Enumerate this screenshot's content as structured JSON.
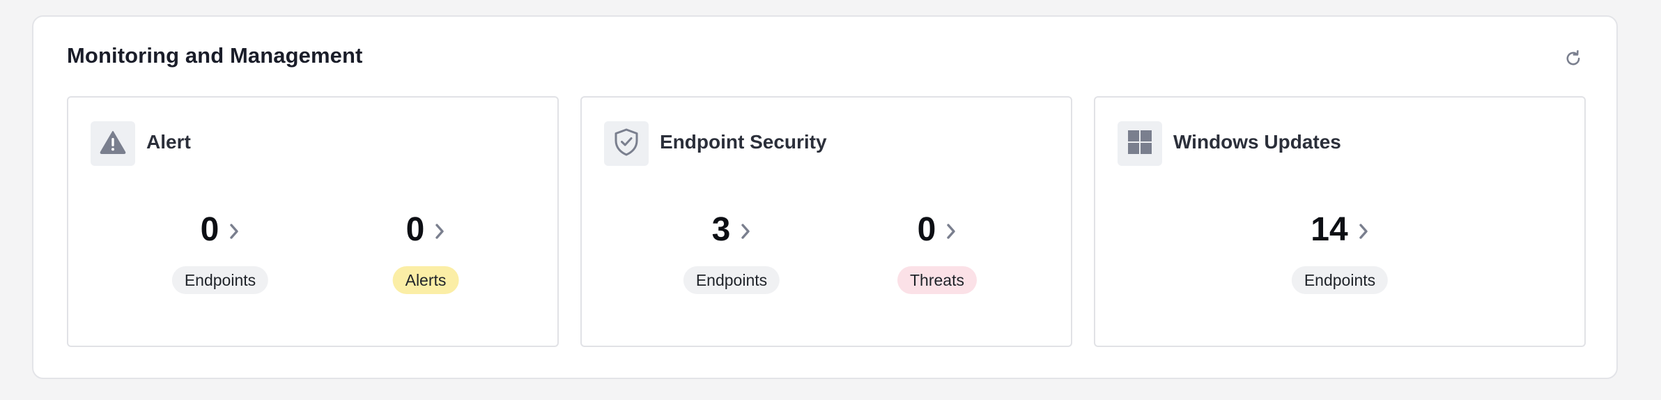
{
  "panel": {
    "title": "Monitoring and Management",
    "refresh_icon": "refresh-icon"
  },
  "cards": [
    {
      "title": "Alert",
      "icon": "warning-triangle-icon",
      "metrics": [
        {
          "value": "0",
          "label": "Endpoints",
          "tone": "neutral"
        },
        {
          "value": "0",
          "label": "Alerts",
          "tone": "yellow"
        }
      ]
    },
    {
      "title": "Endpoint Security",
      "icon": "shield-check-icon",
      "metrics": [
        {
          "value": "3",
          "label": "Endpoints",
          "tone": "neutral"
        },
        {
          "value": "0",
          "label": "Threats",
          "tone": "pink"
        }
      ]
    },
    {
      "title": "Windows Updates",
      "icon": "windows-logo-icon",
      "metrics": [
        {
          "value": "14",
          "label": "Endpoints",
          "tone": "neutral"
        }
      ]
    }
  ],
  "colors": {
    "icon_gray": "#7a7f8e",
    "pill_yellow": "#fbeea6",
    "pill_pink": "#fbe1e7",
    "pill_neutral": "#f0f1f3"
  }
}
